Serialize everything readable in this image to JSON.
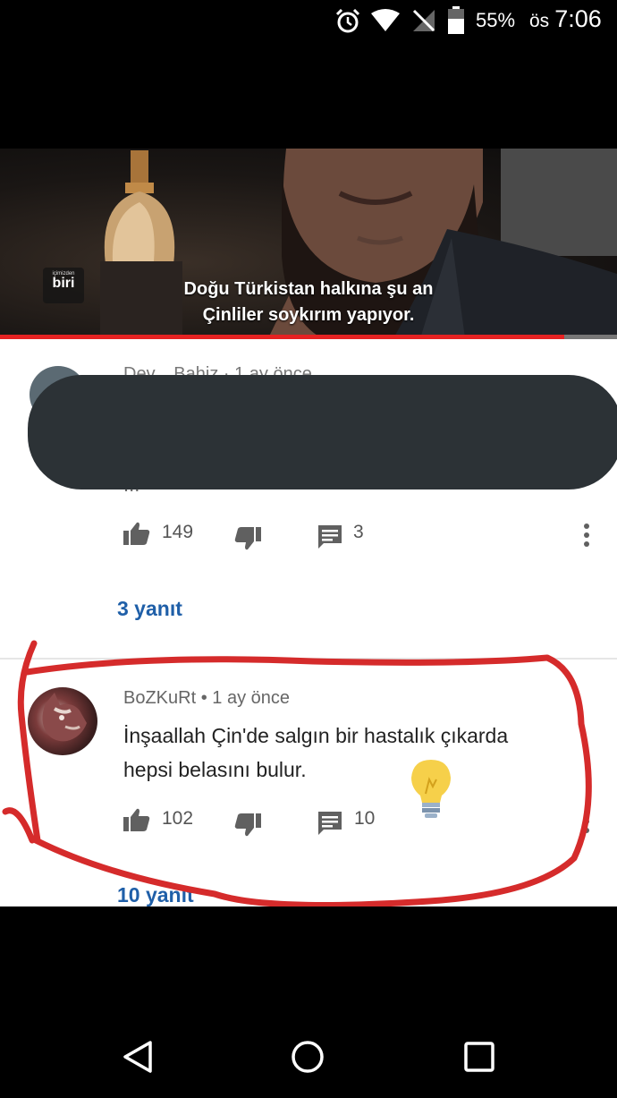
{
  "status_bar": {
    "battery_percent": "55%",
    "ampm": "ös",
    "time": "7:06",
    "icons": [
      "alarm-icon",
      "wifi-icon",
      "no-signal-icon",
      "battery-icon"
    ]
  },
  "video": {
    "channel_logo_small": "içimizden",
    "channel_logo_big": "biri",
    "subtitle_line1": "Doğu Türkistan halkına şu an",
    "subtitle_line2": "Çinliler soykırım yapıyor.",
    "progress_fraction": 0.915
  },
  "comments": [
    {
      "author": "Dev... Bahiz · 1 ay önce",
      "text": "...",
      "redacted": true,
      "likes": "149",
      "replies_count": "3",
      "replies_link": "3 yanıt"
    },
    {
      "author": "BoZKuRt",
      "time": "1 ay önce",
      "text_line1": "İnşaallah Çin'de salgın bir hastalık çıkarda",
      "text_line2": "hepsi belasını bulur.",
      "likes": "102",
      "replies_count": "10",
      "replies_link": "10 yanıt"
    }
  ],
  "colors": {
    "red_marker": "#d52b2b",
    "link_blue": "#1f5fa8",
    "progress_red": "#e52222",
    "redaction": "#2c3236"
  }
}
